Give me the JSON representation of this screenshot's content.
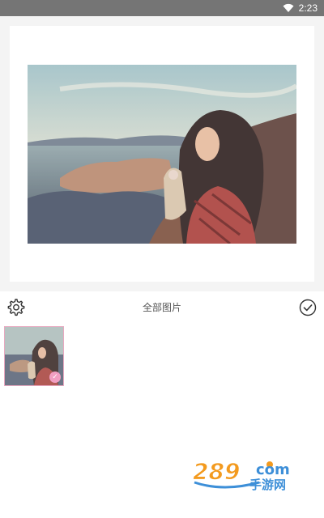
{
  "status_bar": {
    "time": "2:23",
    "wifi_icon": "wifi-icon",
    "background": "#757575"
  },
  "preview": {
    "photo_icon": "selected-photo"
  },
  "toolbar": {
    "settings_icon": "gear-icon",
    "title": "全部图片",
    "confirm_icon": "check-circle-icon"
  },
  "gallery": {
    "items": [
      {
        "icon": "photo-thumbnail",
        "selected": true,
        "check_icon": "check-badge-icon"
      }
    ],
    "accent": "#f19ec2"
  },
  "watermark": {
    "logo": "289 com 手游网"
  }
}
